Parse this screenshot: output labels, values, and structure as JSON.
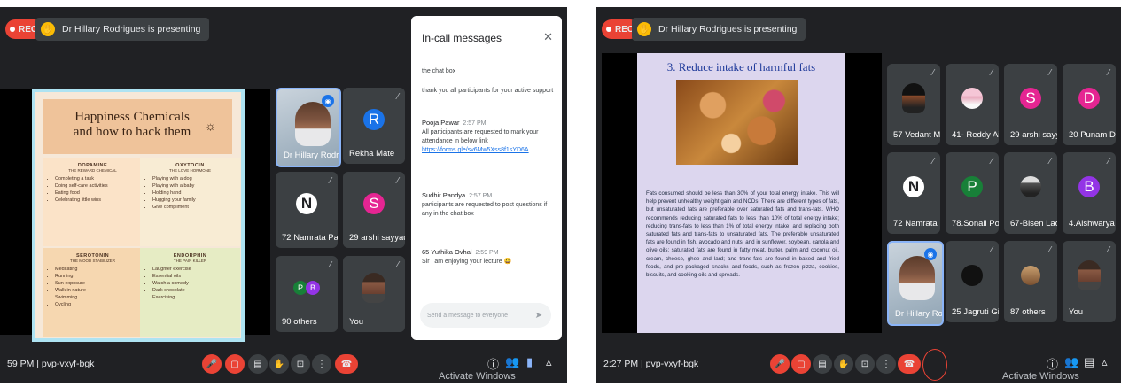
{
  "left": {
    "rec_label": "REC",
    "presenting_text": "Dr Hillary Rodrigues is presenting",
    "slide": {
      "title": "Happiness Chemicals and how to hack them",
      "quadrants": [
        {
          "heading": "DOPAMINE",
          "subtitle": "THE REWARD CHEMICAL",
          "items": [
            "Completing a task",
            "Doing self-care activities",
            "Eating food",
            "Celebrating little wins"
          ]
        },
        {
          "heading": "OXYTOCIN",
          "subtitle": "THE LOVE HORMONE",
          "items": [
            "Playing with a dog",
            "Playing with a baby",
            "Holding hand",
            "Hugging your family",
            "Give compliment"
          ]
        },
        {
          "heading": "SEROTONIN",
          "subtitle": "THE MOOD STABILIZER",
          "items": [
            "Meditating",
            "Running",
            "Sun exposure",
            "Walk in nature",
            "Swimming",
            "Cycling"
          ]
        },
        {
          "heading": "ENDORPHIN",
          "subtitle": "THE PAIN KILLER",
          "items": [
            "Laughter exercise",
            "Essential oils",
            "Watch a comedy",
            "Dark chocolate",
            "Exercising"
          ]
        }
      ]
    },
    "tiles": [
      {
        "name": "Dr Hillary Rodri..."
      },
      {
        "name": "Rekha Mate",
        "initial": "R",
        "color": "#1a73e8"
      },
      {
        "name": "72 Namrata Patil",
        "initial": "N",
        "color": "#ffffff"
      },
      {
        "name": "29 arshi sayyad",
        "initial": "S",
        "color": "#e52592"
      },
      {
        "name": "90 others",
        "initials": [
          "P",
          "B"
        ]
      },
      {
        "name": "You"
      }
    ],
    "chat": {
      "title": "In-call messages",
      "close_icon": "close-icon",
      "messages": [
        {
          "sender": "",
          "time": "",
          "text": "the chat box"
        },
        {
          "sender": "",
          "time": "",
          "text": "thank you all participants for your active support"
        },
        {
          "sender": "Pooja Pawar",
          "time": "2:57 PM",
          "text": "All participants are requested to mark your attendance in below link",
          "link": "https://forms.gle/sv6Mw5Xss8f1sYD6A"
        },
        {
          "sender": "Sudhir Pandya",
          "time": "2:57 PM",
          "text": "participants are requested to post questions if any in the chat box"
        },
        {
          "sender": "65 Yuthika Ovhal",
          "time": "2:59 PM",
          "text": "Sir I am enjoying your lecture 😀"
        }
      ],
      "input_placeholder": "Send a message to everyone"
    },
    "bottom": {
      "meeting_text": "59 PM | pvp-vxyf-bgk",
      "activate": "Activate Windows"
    }
  },
  "right": {
    "rec_label": "REC",
    "presenting_text": "Dr Hillary Rodrigues is presenting",
    "slide": {
      "title": "3. Reduce intake of harmful fats",
      "body": "Fats consumed should be less than 30% of your total energy intake. This will help prevent unhealthy weight gain and NCDs. There are different types of fats, but unsaturated fats are preferable over saturated fats and trans-fats. WHO recommends reducing saturated fats to less than 10% of total energy intake; reducing trans-fats to less than 1% of total energy intake; and replacing both saturated fats and trans-fats to unsaturated fats. The preferable unsaturated fats are found in fish, avocado and nuts, and in sunflower, soybean, canola and olive oils; saturated fats are found in fatty meat, butter, palm and coconut oil, cream, cheese, ghee and lard; and trans-fats are found in baked and fried foods, and pre-packaged snacks and foods, such as frozen pizza, cookies, biscuits, and cooking oils and spreads."
    },
    "tiles": [
      {
        "name": "57 Vedant Mula..."
      },
      {
        "name": "41- Reddy Aish..."
      },
      {
        "name": "29 arshi sayyad",
        "initial": "S",
        "color": "#e52592"
      },
      {
        "name": "20 Punam Dhu...",
        "initial": "D",
        "color": "#e52592"
      },
      {
        "name": "72 Namrata Patil",
        "initial": "N",
        "color": "#ffffff"
      },
      {
        "name": "78.Sonali Poojari",
        "initial": "P",
        "color": "#188038"
      },
      {
        "name": "67-Bisen Ladli"
      },
      {
        "name": "4.Aishwarya Bh...",
        "initial": "B",
        "color": "#9334e6"
      },
      {
        "name": "Dr Hillary Rodri..."
      },
      {
        "name": "25 Jagruti Girase"
      },
      {
        "name": "87 others"
      },
      {
        "name": "You"
      }
    ],
    "bottom": {
      "meeting_text": "2:27 PM | pvp-vxyf-bgk",
      "activate": "Activate Windows"
    }
  }
}
